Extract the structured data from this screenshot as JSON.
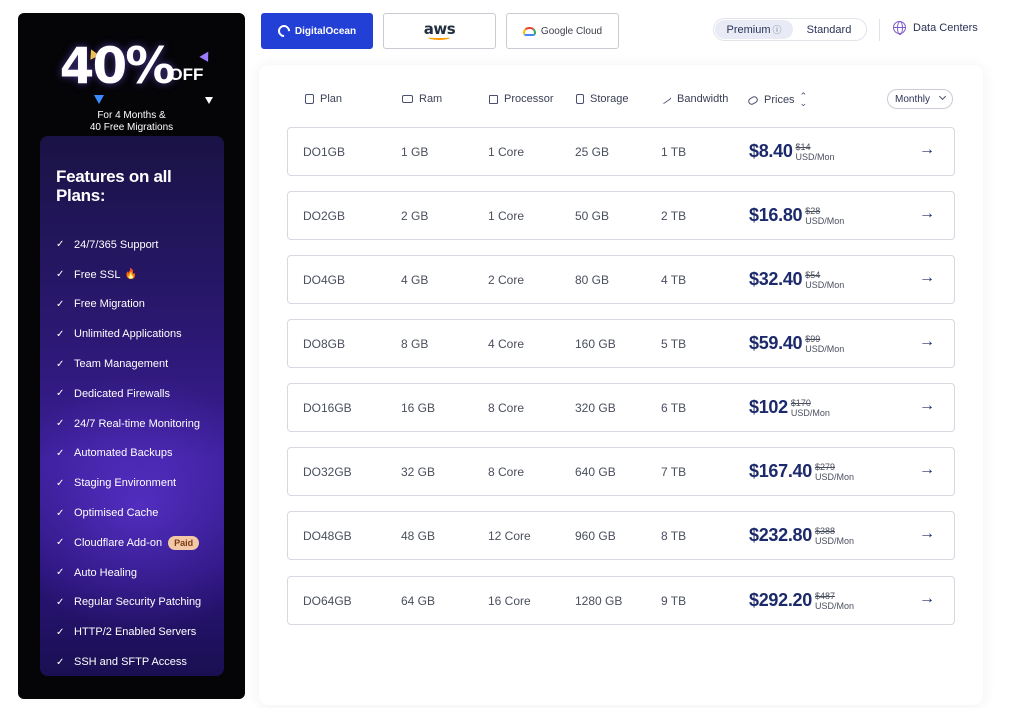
{
  "promo": {
    "discount": "40%",
    "off": "OFF",
    "subtitle_line1": "For 4 Months &",
    "subtitle_line2": "40 Free Migrations",
    "features_title": "Features on all Plans:",
    "features": [
      {
        "label": "24/7/365 Support"
      },
      {
        "label": "Free SSL",
        "icon": "flame-icon"
      },
      {
        "label": "Free Migration"
      },
      {
        "label": "Unlimited Applications"
      },
      {
        "label": "Team Management"
      },
      {
        "label": "Dedicated Firewalls"
      },
      {
        "label": "24/7 Real-time Monitoring"
      },
      {
        "label": "Automated Backups"
      },
      {
        "label": "Staging Environment"
      },
      {
        "label": "Optimised Cache"
      },
      {
        "label": "Cloudflare Add-on",
        "badge": "Paid"
      },
      {
        "label": "Auto Healing"
      },
      {
        "label": "Regular Security Patching"
      },
      {
        "label": "HTTP/2 Enabled Servers"
      },
      {
        "label": "SSH and SFTP Access"
      }
    ]
  },
  "providers": {
    "digitalocean": "DigitalOcean",
    "aws": "aws",
    "googlecloud": "Google Cloud",
    "selected": "DigitalOcean"
  },
  "tiers": {
    "premium": "Premium",
    "standard": "Standard",
    "selected": "Premium"
  },
  "data_centers_label": "Data Centers",
  "table": {
    "headers": {
      "plan": "Plan",
      "ram": "Ram",
      "processor": "Processor",
      "storage": "Storage",
      "bandwidth": "Bandwidth",
      "prices": "Prices"
    },
    "billing_selected": "Monthly",
    "rows": [
      {
        "plan": "DO1GB",
        "ram": "1 GB",
        "cpu": "1 Core",
        "storage": "25 GB",
        "bandwidth": "1 TB",
        "price": "$8.40",
        "old_price": "$14",
        "unit": "USD/Mon"
      },
      {
        "plan": "DO2GB",
        "ram": "2 GB",
        "cpu": "1 Core",
        "storage": "50 GB",
        "bandwidth": "2 TB",
        "price": "$16.80",
        "old_price": "$28",
        "unit": "USD/Mon"
      },
      {
        "plan": "DO4GB",
        "ram": "4 GB",
        "cpu": "2 Core",
        "storage": "80 GB",
        "bandwidth": "4 TB",
        "price": "$32.40",
        "old_price": "$54",
        "unit": "USD/Mon"
      },
      {
        "plan": "DO8GB",
        "ram": "8 GB",
        "cpu": "4 Core",
        "storage": "160 GB",
        "bandwidth": "5 TB",
        "price": "$59.40",
        "old_price": "$99",
        "unit": "USD/Mon"
      },
      {
        "plan": "DO16GB",
        "ram": "16 GB",
        "cpu": "8 Core",
        "storage": "320 GB",
        "bandwidth": "6 TB",
        "price": "$102",
        "old_price": "$170",
        "unit": "USD/Mon"
      },
      {
        "plan": "DO32GB",
        "ram": "32 GB",
        "cpu": "8 Core",
        "storage": "640 GB",
        "bandwidth": "7 TB",
        "price": "$167.40",
        "old_price": "$279",
        "unit": "USD/Mon"
      },
      {
        "plan": "DO48GB",
        "ram": "48 GB",
        "cpu": "12 Core",
        "storage": "960 GB",
        "bandwidth": "8 TB",
        "price": "$232.80",
        "old_price": "$388",
        "unit": "USD/Mon"
      },
      {
        "plan": "DO64GB",
        "ram": "64 GB",
        "cpu": "16 Core",
        "storage": "1280 GB",
        "bandwidth": "9 TB",
        "price": "$292.20",
        "old_price": "$487",
        "unit": "USD/Mon"
      }
    ]
  },
  "colors": {
    "accent": "#2340d6",
    "price_text": "#1c2a6b",
    "promo_bg": "#050508",
    "features_bg": "#2a1870",
    "paid_badge": "#f3c8a6"
  }
}
